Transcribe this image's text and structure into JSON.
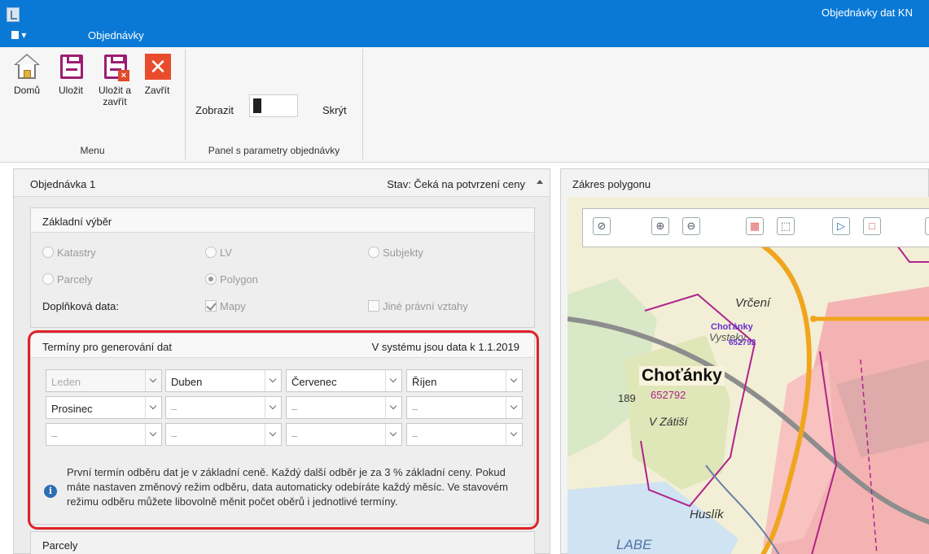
{
  "window": {
    "title": "Objednávky dat KN"
  },
  "menu": {
    "toggle_glyph": "▾",
    "tab": "Objednávky"
  },
  "ribbon": {
    "buttons": [
      {
        "label": "Domů",
        "icon": "home-icon"
      },
      {
        "label": "Uložit",
        "icon": "save-icon"
      },
      {
        "label": "Uložit a zavřít",
        "icon": "save-close-icon"
      },
      {
        "label": "Zavřít",
        "icon": "close-icon"
      }
    ],
    "menu_group": "Menu",
    "params": {
      "show": "Zobrazit",
      "hide": "Skrýt",
      "group": "Panel s parametry objednávky"
    }
  },
  "order": {
    "title": "Objednávka 1",
    "status": "Stav: Čeká na potvrzení ceny",
    "basic": {
      "title": "Základní výběr",
      "options": [
        "Katastry",
        "LV",
        "Subjekty",
        "Parcely",
        "Polygon"
      ],
      "selected": "Polygon",
      "extra_label": "Doplňková data:",
      "extra": [
        {
          "label": "Mapy",
          "checked": true
        },
        {
          "label": "Jiné právní vztahy",
          "checked": false
        }
      ]
    },
    "terms": {
      "title": "Termíny pro generování dat",
      "system_info": "V systému jsou data k 1.1.2019",
      "rows": [
        [
          "Leden",
          "Duben",
          "Červenec",
          "Říjen"
        ],
        [
          "Prosinec",
          "–",
          "–",
          "–"
        ],
        [
          "–",
          "–",
          "–",
          "–"
        ]
      ],
      "info": "První termín odběru dat je v základní ceně. Každý další odběr je za 3 % základní ceny. Pokud máte nastaven změnový režim odběru, data automaticky odebíráte každý měsíc. Ve stavovém režimu odběru můžete libovolně měnit počet oběrů i jednotlivé termíny."
    },
    "parcels": {
      "title": "Parcely"
    }
  },
  "map": {
    "title": "Zákres polygonu",
    "labels": [
      "Vrčení",
      "Choťánky",
      "652792",
      "189",
      "V Zátiší",
      "Huslík",
      "LABE",
      "Choťánky",
      "Vysteky",
      "652792"
    ],
    "colors": {
      "accent": "#0a79d6",
      "highlight": "#e02228",
      "polygon": "#b0238c",
      "road": "#f0a51e"
    }
  }
}
